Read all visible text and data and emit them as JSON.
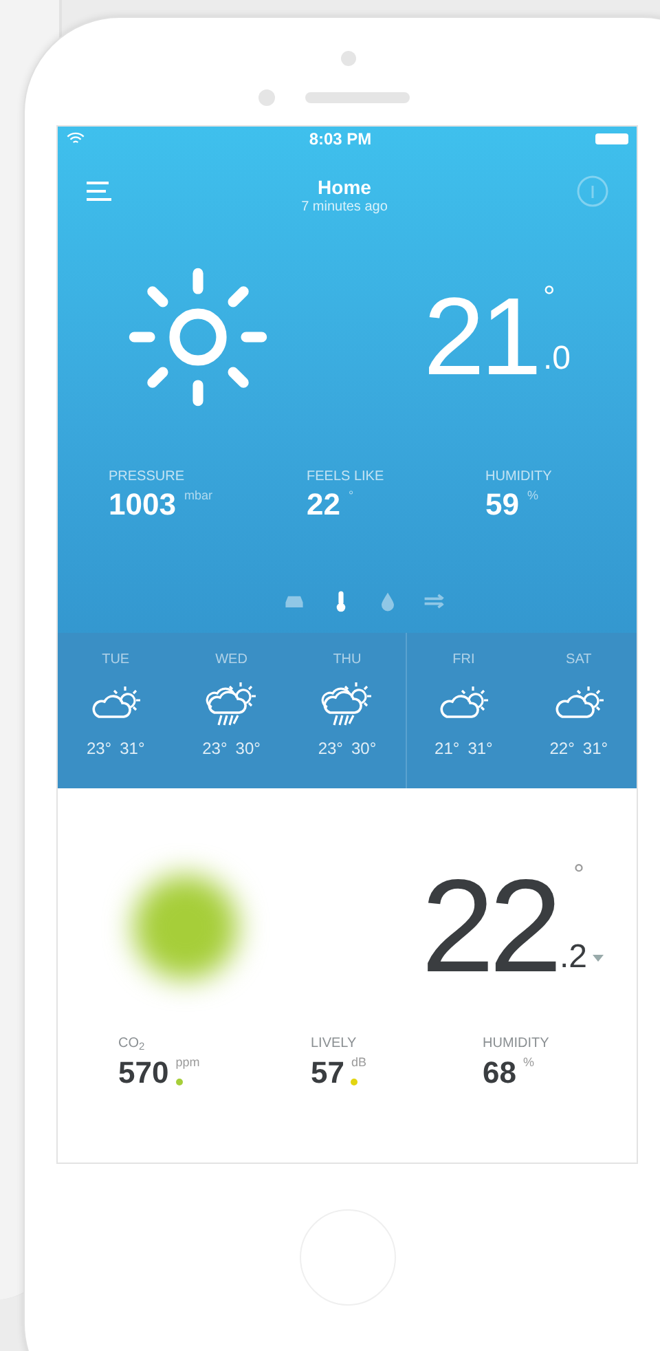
{
  "status_bar": {
    "time": "8:03 PM"
  },
  "header": {
    "title": "Home",
    "subtitle": "7 minutes ago"
  },
  "outdoor": {
    "temperature": "21",
    "decimal": ".0",
    "degree": "°",
    "stats": [
      {
        "label": "PRESSURE",
        "value": "1003",
        "unit": "mbar"
      },
      {
        "label": "FEELS LIKE",
        "value": "22",
        "unit": "°"
      },
      {
        "label": "HUMIDITY",
        "value": "59",
        "unit": "%"
      }
    ],
    "modes": [
      {
        "kind": "car",
        "selected": false
      },
      {
        "kind": "thermometer",
        "selected": true
      },
      {
        "kind": "drop",
        "selected": false
      },
      {
        "kind": "wind",
        "selected": false
      }
    ]
  },
  "forecast": [
    {
      "day": "TUE",
      "kind": "partly_cloudy",
      "low": "23°",
      "high": "31°"
    },
    {
      "day": "WED",
      "kind": "storm",
      "low": "23°",
      "high": "30°"
    },
    {
      "day": "THU",
      "kind": "storm",
      "low": "23°",
      "high": "30°"
    },
    {
      "day": "FRI",
      "kind": "partly_cloudy",
      "low": "21°",
      "high": "31°"
    },
    {
      "day": "SAT",
      "kind": "partly_cloudy",
      "low": "22°",
      "high": "31°"
    }
  ],
  "indoor": {
    "temperature": "22",
    "decimal": ".2",
    "degree": "°",
    "stats": [
      {
        "label": "CO$_{2}$",
        "value": "570",
        "unit": "ppm",
        "color": "#a6ce39"
      },
      {
        "label": "LIVELY",
        "value": "57",
        "unit": "dB",
        "color": "#e2d510"
      },
      {
        "label": "HUMIDITY",
        "value": "68",
        "unit": "%"
      }
    ]
  }
}
